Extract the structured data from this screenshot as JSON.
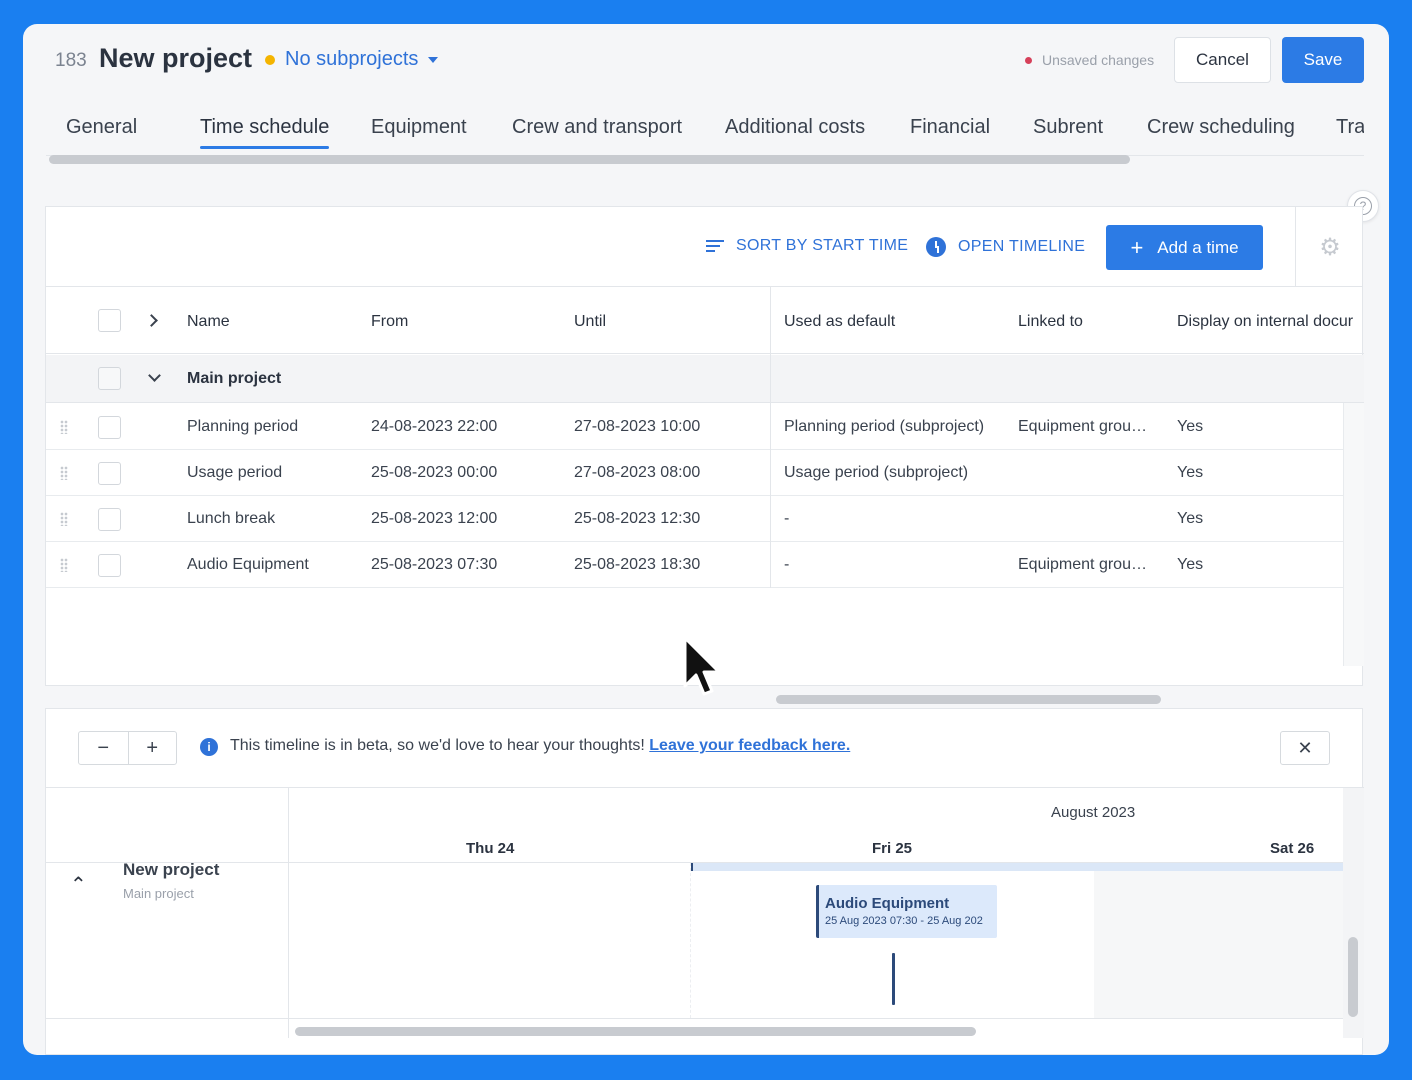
{
  "header": {
    "project_number": "183",
    "project_title": "New project",
    "subprojects_label": "No subprojects",
    "unsaved_label": "Unsaved changes",
    "cancel_label": "Cancel",
    "save_label": "Save"
  },
  "tabs": [
    {
      "label": "General"
    },
    {
      "label": "Time schedule",
      "active": true
    },
    {
      "label": "Equipment"
    },
    {
      "label": "Crew and transport"
    },
    {
      "label": "Additional costs"
    },
    {
      "label": "Financial"
    },
    {
      "label": "Subrent"
    },
    {
      "label": "Crew scheduling"
    },
    {
      "label": "Trans"
    }
  ],
  "toolbar": {
    "sort_label": "SORT BY START TIME",
    "timeline_label": "OPEN TIMELINE",
    "add_label": "Add a time"
  },
  "table": {
    "columns": [
      "Name",
      "From",
      "Until",
      "Used as default",
      "Linked to",
      "Display on internal docur"
    ],
    "group": "Main project",
    "rows": [
      {
        "name": "Planning period",
        "from": "24-08-2023 22:00",
        "until": "27-08-2023 10:00",
        "default": "Planning period (subproject)",
        "linked": "Equipment grou…",
        "display": "Yes"
      },
      {
        "name": "Usage period",
        "from": "25-08-2023 00:00",
        "until": "27-08-2023 08:00",
        "default": "Usage period (subproject)",
        "linked": "",
        "display": "Yes"
      },
      {
        "name": "Lunch break",
        "from": "25-08-2023 12:00",
        "until": "25-08-2023 12:30",
        "default": "-",
        "linked": "",
        "display": "Yes"
      },
      {
        "name": "Audio Equipment",
        "from": "25-08-2023 07:30",
        "until": "25-08-2023 18:30",
        "default": "-",
        "linked": "Equipment grou…",
        "display": "Yes"
      }
    ]
  },
  "timeline": {
    "zoom_out": "−",
    "zoom_in": "+",
    "beta_text": "This timeline is in beta, so we'd love to hear your thoughts! ",
    "beta_link": "Leave your feedback here.",
    "close": "✕",
    "month": "August 2023",
    "days": [
      "Thu 24",
      "Fri 25",
      "Sat 26"
    ],
    "project_name": "New project",
    "project_sub": "Main project",
    "event_title": "Audio Equipment",
    "event_time": "25 Aug 2023 07:30 - 25 Aug 202"
  },
  "colors": {
    "background": "#1a7ff0",
    "accent": "#2c7be5",
    "status_dot": "#f4b400",
    "unsaved_dot": "#d6405a",
    "event": "#2c4a7a"
  },
  "icons": [
    "caret-down-icon",
    "sort-icon",
    "clock-icon",
    "plus-icon",
    "gear-icon",
    "help-icon",
    "chevron-right-icon",
    "chevron-down-icon",
    "drag-handle-icon",
    "info-icon",
    "close-icon",
    "collapse-up-icon",
    "mouse-cursor-icon"
  ]
}
